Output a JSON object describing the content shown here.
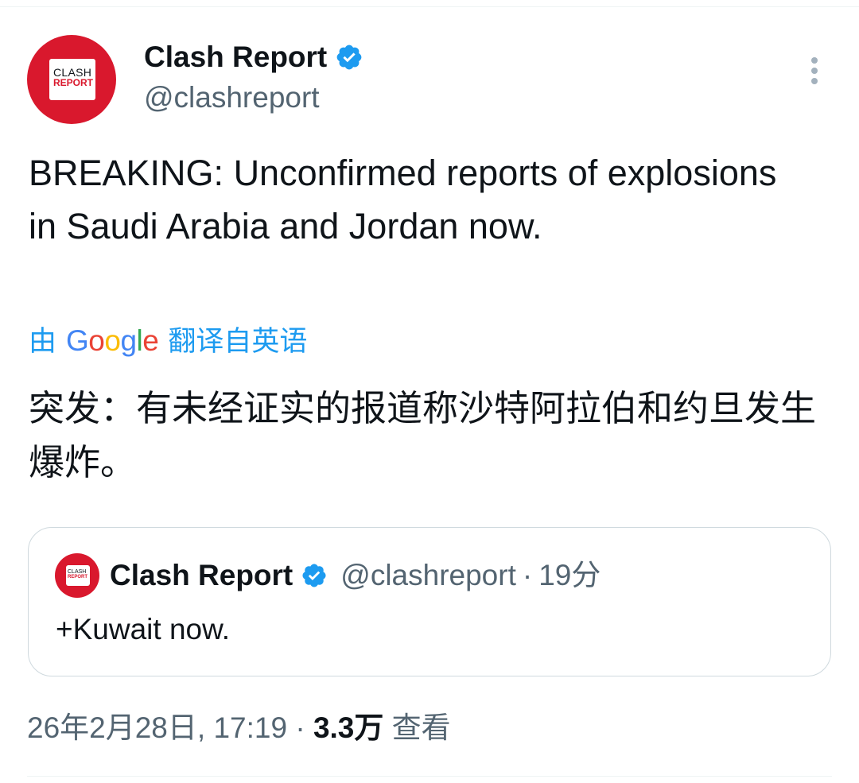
{
  "author": {
    "name": "Clash Report",
    "handle": "@clashreport",
    "avatar_text_top": "CLASH",
    "avatar_text_bottom": "REPORT",
    "avatar_color": "#d9182d",
    "verified_color": "#1d9bf0",
    "verified_icon": "verified-badge-icon"
  },
  "more_icon": "more-vertical-icon",
  "tweet": {
    "text": "BREAKING: Unconfirmed reports of explosions in Saudi Arabia and Jordan now."
  },
  "translation": {
    "by_label": "由",
    "google_logo_text": "Google",
    "from_label": "翻译自英语",
    "text": "突发：有未经证实的报道称沙特阿拉伯和约旦发生爆炸。"
  },
  "quote": {
    "name": "Clash Report",
    "handle": "@clashreport",
    "separator": "·",
    "time": "19分",
    "text": "+Kuwait now."
  },
  "meta": {
    "datetime": "26年2月28日, 17:19",
    "separator": "·",
    "views_count": "3.3万",
    "views_label": "查看"
  }
}
